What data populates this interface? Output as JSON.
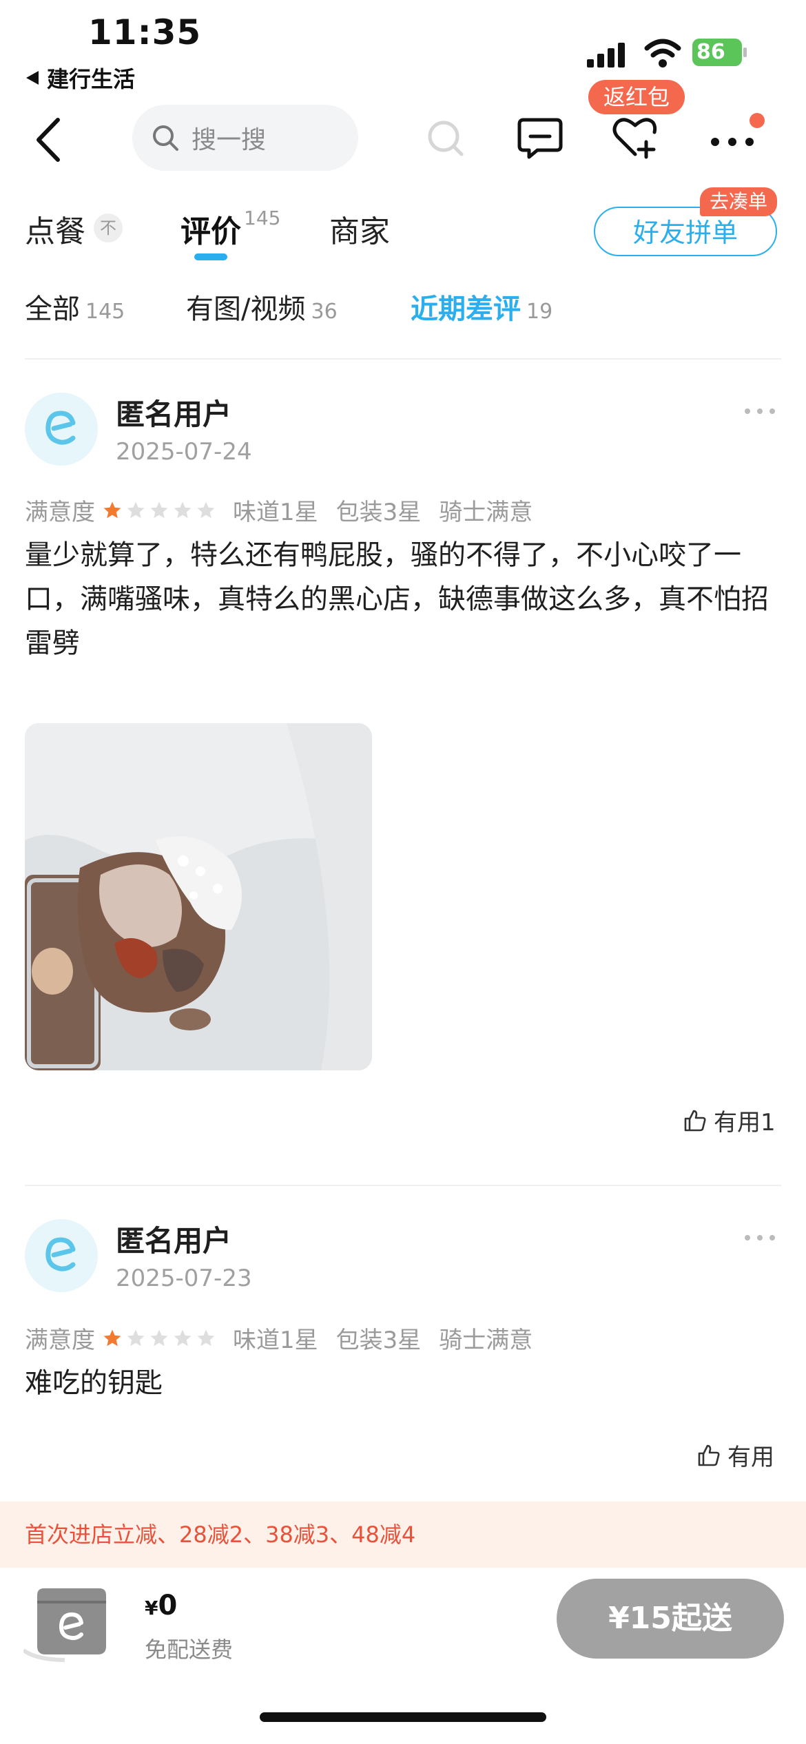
{
  "status_bar": {
    "time": "11:35",
    "back_app": "建行生活",
    "battery": "86"
  },
  "nav": {
    "search_placeholder": "搜一搜",
    "redbag_badge": "返红包"
  },
  "tabs": [
    {
      "label": "点餐",
      "pin": "不"
    },
    {
      "label": "评价",
      "sup": "145"
    },
    {
      "label": "商家"
    }
  ],
  "friend_order": {
    "label": "好友拼单",
    "badge": "去凑单"
  },
  "filters": [
    {
      "label": "全部",
      "count": "145"
    },
    {
      "label": "有图/视频",
      "count": "36"
    },
    {
      "label": "近期差评",
      "count": "19"
    }
  ],
  "reviews": [
    {
      "user": "匿名用户",
      "date": "2025-07-24",
      "satisfaction_label": "满意度",
      "stars": 1,
      "tags": [
        "味道1星",
        "包装3星",
        "骑士满意"
      ],
      "text": "量少就算了，特么还有鸭屁股，骚的不得了，不小心咬了一口，满嘴骚味，真特么的黑心店，缺德事做这么多，真不怕招雷劈",
      "useful": "有用1"
    },
    {
      "user": "匿名用户",
      "date": "2025-07-23",
      "satisfaction_label": "满意度",
      "stars": 1,
      "tags": [
        "味道1星",
        "包装3星",
        "骑士满意"
      ],
      "text": "难吃的钥匙",
      "useful": "有用"
    }
  ],
  "promo": "首次进店立减、28减2、38减3、48减4",
  "cart": {
    "currency": "¥",
    "amount": "0",
    "delivery": "免配送费",
    "min_order": "¥15起送"
  },
  "colors": {
    "accent": "#2aaeed",
    "red": "#f4684e",
    "star": "#f47a30"
  }
}
